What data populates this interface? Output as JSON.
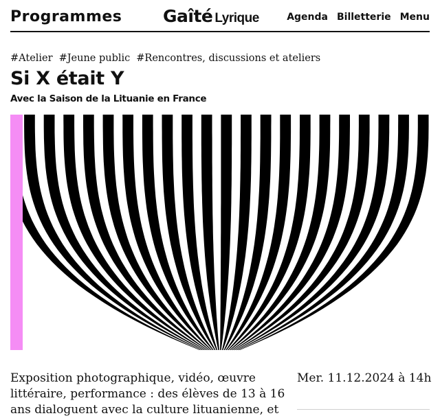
{
  "header": {
    "programmes_label": "Programmes",
    "logo_main": "Gaîté",
    "logo_sub": "Lyrique",
    "nav": [
      "Agenda",
      "Billetterie",
      "Menu"
    ]
  },
  "event": {
    "tags": [
      "#Atelier",
      "#Jeune public",
      "#Rencontres, discussions et ateliers"
    ],
    "title": "Si X était Y",
    "subtitle": "Avec la Saison de la Lituanie en France",
    "description": "Exposition photographique, vidéo, œuvre littéraire, performance : des élèves de 13 à 16 ans dialoguent avec la culture lituanienne, et",
    "date": "Mer. 11.12.2024 à 14h"
  },
  "hero_image": {
    "pattern": "black-and-white curved stripes",
    "colors": {
      "stripe": "#000000",
      "background": "#ffffff",
      "accent_band": "#f58df5"
    }
  }
}
